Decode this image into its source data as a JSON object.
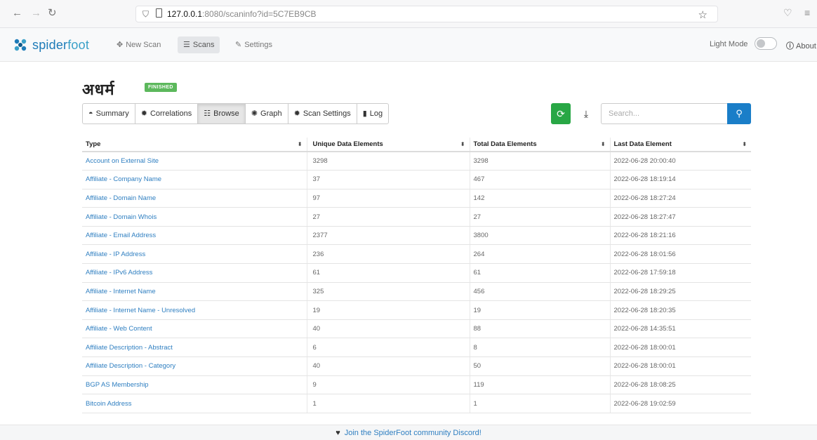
{
  "browser": {
    "url_host": "127.0.0.1",
    "url_path": ":8080/scaninfo?id=5C7EB9CB",
    "nav_back": "←",
    "nav_forward": "→",
    "nav_reload": "↻",
    "star_glyph": "☆",
    "shield_glyph": "⛉",
    "pocket_glyph": "♡",
    "menu_glyph": "≡"
  },
  "navbar": {
    "brand_main": "spider",
    "brand_foot": "foot",
    "new_scan": "New Scan",
    "scans": "Scans",
    "settings": "Settings",
    "light_mode": "Light Mode",
    "about": "About"
  },
  "scan": {
    "name": "अधर्म",
    "status": "FINISHED"
  },
  "tabs": {
    "summary": "Summary",
    "correlations": "Correlations",
    "browse": "Browse",
    "graph": "Graph",
    "scan_settings": "Scan Settings",
    "log": "Log"
  },
  "search": {
    "placeholder": "Search..."
  },
  "table": {
    "headers": [
      "Type",
      "Unique Data Elements",
      "Total Data Elements",
      "Last Data Element"
    ],
    "rows": [
      [
        "Account on External Site",
        "3298",
        "3298",
        "2022-06-28 20:00:40"
      ],
      [
        "Affiliate - Company Name",
        "37",
        "467",
        "2022-06-28 18:19:14"
      ],
      [
        "Affiliate - Domain Name",
        "97",
        "142",
        "2022-06-28 18:27:24"
      ],
      [
        "Affiliate - Domain Whois",
        "27",
        "27",
        "2022-06-28 18:27:47"
      ],
      [
        "Affiliate - Email Address",
        "2377",
        "3800",
        "2022-06-28 18:21:16"
      ],
      [
        "Affiliate - IP Address",
        "236",
        "264",
        "2022-06-28 18:01:56"
      ],
      [
        "Affiliate - IPv6 Address",
        "61",
        "61",
        "2022-06-28 17:59:18"
      ],
      [
        "Affiliate - Internet Name",
        "325",
        "456",
        "2022-06-28 18:29:25"
      ],
      [
        "Affiliate - Internet Name - Unresolved",
        "19",
        "19",
        "2022-06-28 18:20:35"
      ],
      [
        "Affiliate - Web Content",
        "40",
        "88",
        "2022-06-28 14:35:51"
      ],
      [
        "Affiliate Description - Abstract",
        "6",
        "8",
        "2022-06-28 18:00:01"
      ],
      [
        "Affiliate Description - Category",
        "40",
        "50",
        "2022-06-28 18:00:01"
      ],
      [
        "BGP AS Membership",
        "9",
        "119",
        "2022-06-28 18:08:25"
      ],
      [
        "Bitcoin Address",
        "1",
        "1",
        "2022-06-28 19:02:59"
      ]
    ]
  },
  "footer": {
    "discord": "Join the SpiderFoot community Discord!"
  }
}
